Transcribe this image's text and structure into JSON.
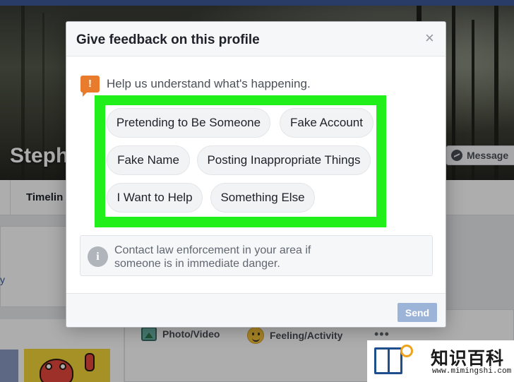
{
  "profile": {
    "name_partial": "Steph",
    "message_button": "Message",
    "timeline_tab": "Timelin",
    "left_fragment": "y"
  },
  "composer": {
    "photo_video": "Photo/Video",
    "feeling_activity": "Feeling/Activity",
    "more": "•••"
  },
  "dialog": {
    "title": "Give feedback on this profile",
    "close_glyph": "×",
    "prompt": "Help us understand what's happening.",
    "alert_glyph": "!",
    "options": [
      "Pretending to Be Someone",
      "Fake Account",
      "Fake Name",
      "Posting Inappropriate Things",
      "I Want to Help",
      "Something Else"
    ],
    "info_glyph": "i",
    "info_text": "Contact law enforcement in your area if someone is in immediate danger.",
    "send_label": "Send"
  },
  "watermark": {
    "title": "知识百科",
    "url": "www.mimingshi.com"
  },
  "colors": {
    "facebook_blue": "#3b5998",
    "highlight_green": "#20ef1a",
    "alert_orange": "#e87b2c",
    "send_disabled": "#9cb4d8"
  }
}
